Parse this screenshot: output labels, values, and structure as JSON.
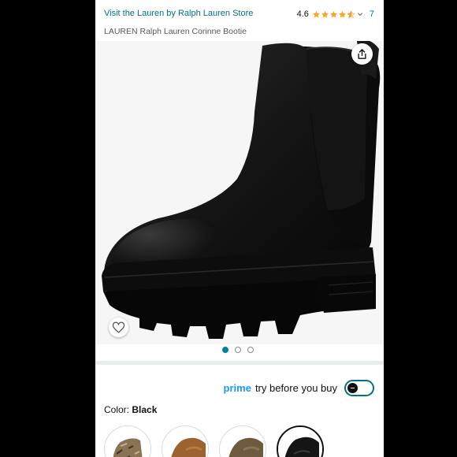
{
  "header": {
    "store_link": "Visit the Lauren by Ralph Lauren Store",
    "rating_value": "4.6",
    "rating_stars": 4.6,
    "rating_count": "7"
  },
  "product": {
    "title": "LAUREN Ralph Lauren Corinne Bootie",
    "image_count": 3,
    "active_image": 1
  },
  "prime": {
    "prime_word": "prime",
    "label": "try before you buy",
    "toggle_on": false
  },
  "color": {
    "label": "Color:",
    "value": "Black",
    "swatches": [
      "snake",
      "cognac",
      "olive",
      "black"
    ],
    "selected_swatch": 3
  },
  "colors": {
    "link": "#007185",
    "prime_blue": "#1a98ff",
    "star": "#ffa41c",
    "dot_active": "#008296"
  },
  "icons": {
    "share": "share-icon",
    "wishlist": "heart-icon"
  }
}
